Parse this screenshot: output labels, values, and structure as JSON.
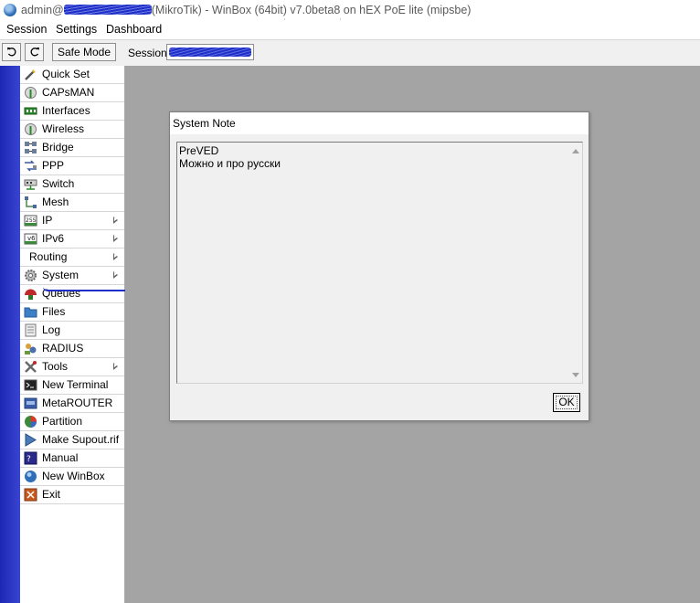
{
  "window": {
    "title_prefix": "admin@",
    "title_middle": "(MikroTik) - WinBox (64bit) ",
    "version": "v7.0beta8",
    "title_suffix": " on hEX PoE lite (mipsbe)"
  },
  "menu": [
    "Session",
    "Settings",
    "Dashboard"
  ],
  "toolbar": {
    "undo_icon": "undo-icon",
    "redo_icon": "redo-icon",
    "safe_mode_label": "Safe Mode",
    "session_label": "Session:"
  },
  "sidebar": {
    "items": [
      {
        "label": "Quick Set",
        "icon": "quick-set-icon",
        "submenu": false
      },
      {
        "label": "CAPsMAN",
        "icon": "capsman-icon",
        "submenu": false
      },
      {
        "label": "Interfaces",
        "icon": "interfaces-icon",
        "submenu": false
      },
      {
        "label": "Wireless",
        "icon": "wireless-icon",
        "submenu": false
      },
      {
        "label": "Bridge",
        "icon": "bridge-icon",
        "submenu": false
      },
      {
        "label": "PPP",
        "icon": "ppp-icon",
        "submenu": false
      },
      {
        "label": "Switch",
        "icon": "switch-icon",
        "submenu": false
      },
      {
        "label": "Mesh",
        "icon": "mesh-icon",
        "submenu": false
      },
      {
        "label": "IP",
        "icon": "ip-icon",
        "submenu": true
      },
      {
        "label": "IPv6",
        "icon": "ipv6-icon",
        "submenu": true
      },
      {
        "label": "Routing",
        "icon": "",
        "submenu": true
      },
      {
        "label": "System",
        "icon": "gear-icon",
        "submenu": true
      },
      {
        "label": "Queues",
        "icon": "queues-icon",
        "submenu": false
      },
      {
        "label": "Files",
        "icon": "folder-icon",
        "submenu": false
      },
      {
        "label": "Log",
        "icon": "log-icon",
        "submenu": false
      },
      {
        "label": "RADIUS",
        "icon": "radius-icon",
        "submenu": false
      },
      {
        "label": "Tools",
        "icon": "tools-icon",
        "submenu": true
      },
      {
        "label": "New Terminal",
        "icon": "terminal-icon",
        "submenu": false
      },
      {
        "label": "MetaROUTER",
        "icon": "metarouter-icon",
        "submenu": false
      },
      {
        "label": "Partition",
        "icon": "partition-icon",
        "submenu": false
      },
      {
        "label": "Make Supout.rif",
        "icon": "supout-icon",
        "submenu": false
      },
      {
        "label": "Manual",
        "icon": "manual-icon",
        "submenu": false
      },
      {
        "label": "New WinBox",
        "icon": "winbox-icon",
        "submenu": false
      },
      {
        "label": "Exit",
        "icon": "exit-icon",
        "submenu": false
      }
    ]
  },
  "dialog": {
    "title": "System Note",
    "lines": [
      "PreVED",
      "Можно и про русски"
    ],
    "ok_label": "OK"
  }
}
